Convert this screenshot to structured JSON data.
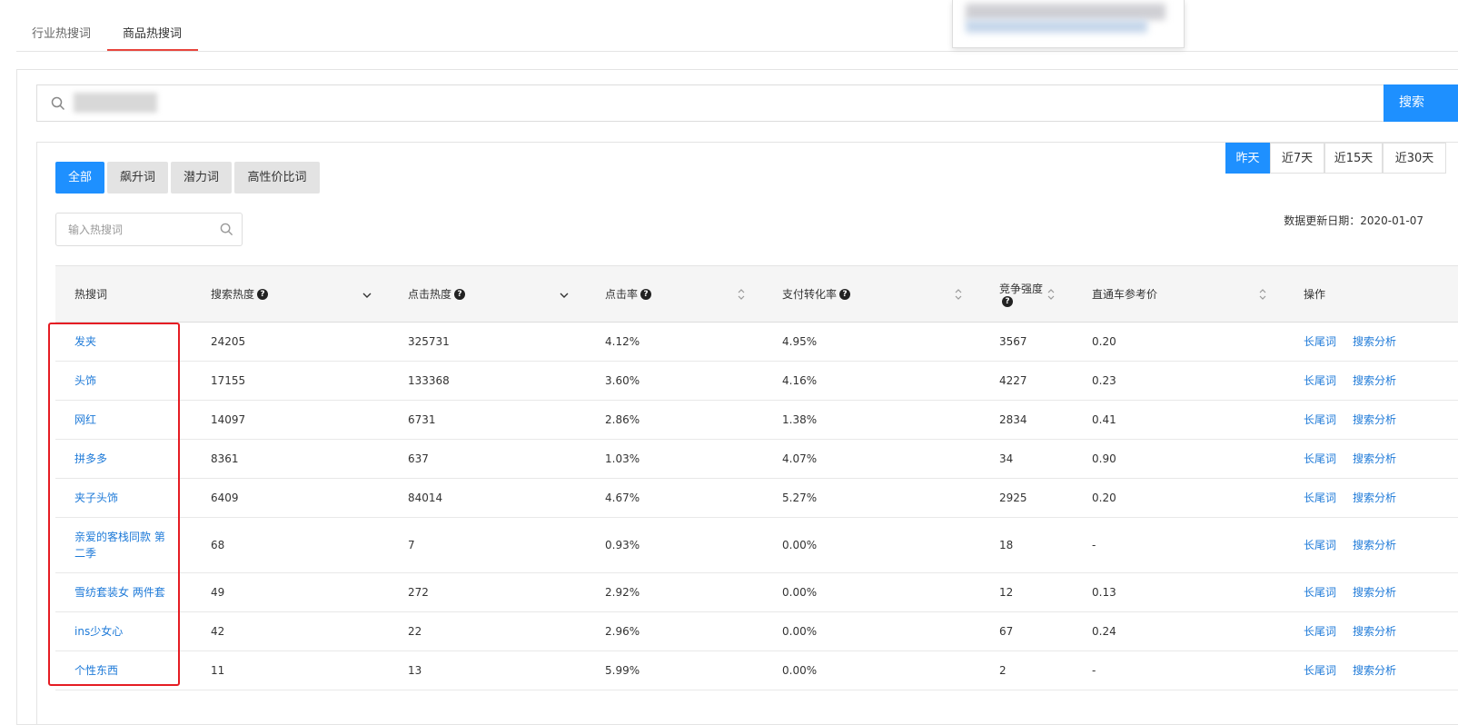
{
  "top_tabs": [
    {
      "label": "行业热搜词",
      "active": false
    },
    {
      "label": "商品热搜词",
      "active": true
    }
  ],
  "search": {
    "button_label": "搜索"
  },
  "date_tabs": [
    {
      "label": "昨天",
      "active": true
    },
    {
      "label": "近7天",
      "active": false
    },
    {
      "label": "近15天",
      "active": false
    },
    {
      "label": "近30天",
      "active": false
    }
  ],
  "filters": [
    {
      "label": "全部",
      "active": true
    },
    {
      "label": "飙升词",
      "active": false
    },
    {
      "label": "潜力词",
      "active": false
    },
    {
      "label": "高性价比词",
      "active": false
    }
  ],
  "hot_search": {
    "placeholder": "输入热搜词"
  },
  "update_date": "数据更新日期：2020-01-07",
  "table": {
    "headers": {
      "keyword": "热搜词",
      "search_heat": "搜索热度",
      "click_heat": "点击热度",
      "ctr": "点击率",
      "conversion": "支付转化率",
      "competition": "竞争强度",
      "ztc_price": "直通车参考价",
      "actions": "操作"
    },
    "action_labels": {
      "long_tail": "长尾词",
      "analysis": "搜索分析"
    },
    "rows": [
      {
        "keyword": "发夹",
        "search_heat": "24205",
        "click_heat": "325731",
        "ctr": "4.12%",
        "conversion": "4.95%",
        "competition": "3567",
        "ztc_price": "0.20"
      },
      {
        "keyword": "头饰",
        "search_heat": "17155",
        "click_heat": "133368",
        "ctr": "3.60%",
        "conversion": "4.16%",
        "competition": "4227",
        "ztc_price": "0.23"
      },
      {
        "keyword": "网红",
        "search_heat": "14097",
        "click_heat": "6731",
        "ctr": "2.86%",
        "conversion": "1.38%",
        "competition": "2834",
        "ztc_price": "0.41"
      },
      {
        "keyword": "拼多多",
        "search_heat": "8361",
        "click_heat": "637",
        "ctr": "1.03%",
        "conversion": "4.07%",
        "competition": "34",
        "ztc_price": "0.90"
      },
      {
        "keyword": "夹子头饰",
        "search_heat": "6409",
        "click_heat": "84014",
        "ctr": "4.67%",
        "conversion": "5.27%",
        "competition": "2925",
        "ztc_price": "0.20"
      },
      {
        "keyword": "亲爱的客栈同款 第二季",
        "search_heat": "68",
        "click_heat": "7",
        "ctr": "0.93%",
        "conversion": "0.00%",
        "competition": "18",
        "ztc_price": "-"
      },
      {
        "keyword": "雪纺套装女 两件套",
        "search_heat": "49",
        "click_heat": "272",
        "ctr": "2.92%",
        "conversion": "0.00%",
        "competition": "12",
        "ztc_price": "0.13"
      },
      {
        "keyword": "ins少女心",
        "search_heat": "42",
        "click_heat": "22",
        "ctr": "2.96%",
        "conversion": "0.00%",
        "competition": "67",
        "ztc_price": "0.24"
      },
      {
        "keyword": "个性东西",
        "search_heat": "11",
        "click_heat": "13",
        "ctr": "5.99%",
        "conversion": "0.00%",
        "competition": "2",
        "ztc_price": "-"
      }
    ]
  },
  "colors": {
    "accent": "#1e90ff",
    "link": "#1e7ad8",
    "highlight": "#e51c23",
    "tab_underline": "#e8453c"
  }
}
